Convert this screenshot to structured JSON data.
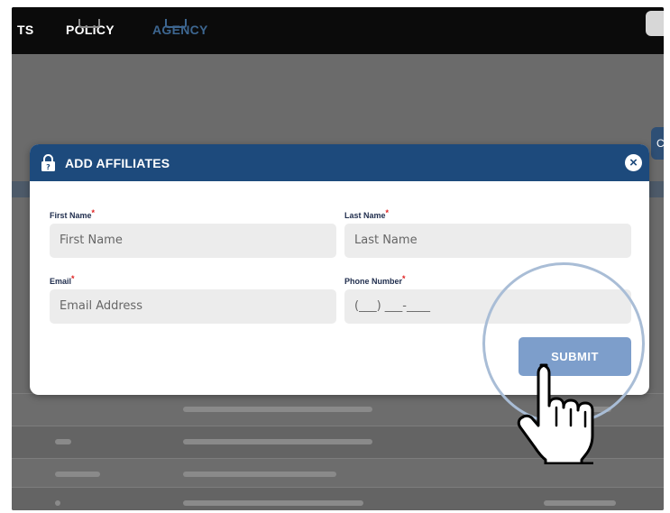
{
  "topnav": {
    "partial_label": "TS",
    "policy": "POLICY",
    "agency": "AGENCY",
    "side_tab": "C"
  },
  "modal": {
    "title": "ADD AFFILIATES",
    "close": "×",
    "fields": {
      "first_name": {
        "label": "First Name",
        "placeholder": "First Name",
        "required": "*"
      },
      "last_name": {
        "label": "Last Name",
        "placeholder": "Last Name",
        "required": "*"
      },
      "email": {
        "label": "Email",
        "placeholder": "Email Address",
        "required": "*"
      },
      "phone": {
        "label": "Phone Number",
        "placeholder": "(___) ___-____",
        "required": "*"
      }
    },
    "submit_label": "SUBMIT"
  },
  "colors": {
    "header": "#1d4a7c",
    "submit": "#7d9ecb",
    "required": "#e02020"
  },
  "icons": [
    "lock-icon",
    "close-icon",
    "hand-pointer-icon"
  ]
}
